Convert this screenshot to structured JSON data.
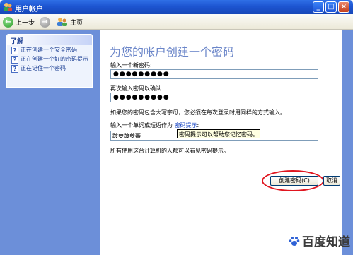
{
  "window": {
    "title": "用户帐户",
    "buttons": {
      "minimize": "_",
      "maximize": "□",
      "close": "×"
    }
  },
  "toolbar": {
    "back_label": "上一步",
    "home_label": "主页"
  },
  "sidebar": {
    "header": "了解",
    "items": [
      {
        "icon": "help-icon",
        "label": "正在创建一个安全密码"
      },
      {
        "icon": "help-icon",
        "label": "正在创建一个好的密码提示"
      },
      {
        "icon": "help-icon",
        "label": "正在记住一个密码"
      }
    ]
  },
  "main": {
    "heading": "为您的帐户创建一个密码",
    "new_password_label": "输入一个新密码:",
    "new_password_value": "●●●●●●●●●",
    "confirm_password_label": "再次输入密码以确认:",
    "confirm_password_value": "●●●●●●●●●",
    "case_note": "如果您的密码包含大写字母，您必须在每次登录时用同样的方式输入。",
    "hint_label_prefix": "输入一个单词或短语作为",
    "hint_link": "密码提示",
    "hint_label_suffix": ":",
    "hint_value": "踱萝踱萝蕃",
    "tooltip": "密码提示可以帮助您记忆密码。",
    "visibility_note": "所有使用这台计算机的人都可以看见密码提示。",
    "create_button": "创建密码(C)",
    "cancel_button": "取消"
  },
  "watermark": {
    "text": "百度知道"
  },
  "colors": {
    "titlebar": "#1d55d1",
    "frame": "#6c8fd9",
    "heading": "#6b86c9",
    "highlight_ring": "#e0151f"
  }
}
